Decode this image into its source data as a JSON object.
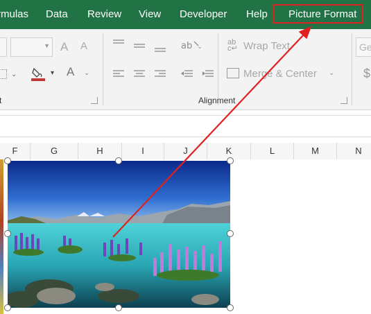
{
  "tabs": [
    {
      "label": "rmulas"
    },
    {
      "label": "Data"
    },
    {
      "label": "Review"
    },
    {
      "label": "View"
    },
    {
      "label": "Developer"
    },
    {
      "label": "Help"
    },
    {
      "label": "Picture Format"
    }
  ],
  "ribbon": {
    "increase_font": "A",
    "decrease_font": "A",
    "font_color": "A",
    "wrap_text": "Wrap Text",
    "merge_center": "Merge & Center",
    "number_format_partial": "Ge",
    "currency_partial": "$",
    "font_group_label_partial": "t",
    "alignment_group_label": "Alignment"
  },
  "columns": [
    "F",
    "G",
    "H",
    "I",
    "J",
    "K",
    "L",
    "M",
    "N"
  ],
  "colors": {
    "brand": "#217346",
    "highlight": "#e02020",
    "arrow": "#e02020"
  }
}
